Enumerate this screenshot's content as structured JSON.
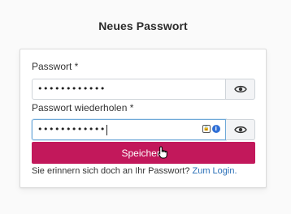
{
  "page": {
    "title": "Neues Passwort"
  },
  "form": {
    "password_label": "Passwort *",
    "password_value": "••••••••••••",
    "repeat_label": "Passwort wiederholen *",
    "repeat_value": "••••••••••••",
    "save_label": "Speichern",
    "footer_text": "Sie erinnern sich doch an Ihr Passwort?",
    "login_link": "Zum Login."
  },
  "icons": {
    "toggle_visibility": "eye-icon",
    "password_manager": "lock-icon",
    "password_manager_info": "info-icon",
    "pointer": "hand-cursor-icon"
  },
  "colors": {
    "accent": "#c2185b",
    "link": "#2a6fb7",
    "focus_border": "#6fa9d8"
  }
}
